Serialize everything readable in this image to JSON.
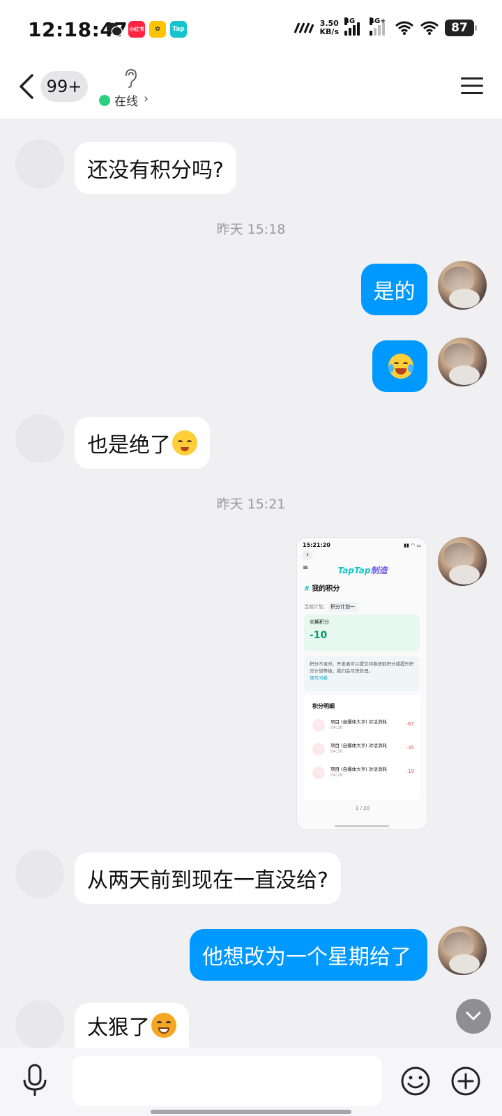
{
  "status_bar": {
    "time": "12:18:47",
    "apps": [
      "wechat-icon",
      "xiaohongshu-icon",
      "app-icon",
      "taptap-icon"
    ],
    "app_labels": {
      "xhs": "小红书",
      "tap": "Tap"
    },
    "net_speed_value": "3.50",
    "net_speed_unit": "KB/s",
    "sim1": "4G",
    "sim2": "4G+",
    "battery": "87"
  },
  "header": {
    "unread": "99+",
    "online_status": "在线",
    "online_color": "#29d17e"
  },
  "messages": [
    {
      "side": "in",
      "text": "还没有积分吗?"
    },
    {
      "timestamp": "昨天 15:18"
    },
    {
      "side": "out",
      "text": "是的"
    },
    {
      "side": "out",
      "emoji": "tears-of-joy-emoji"
    },
    {
      "side": "in",
      "text": "也是绝了",
      "emoji": "speechless-emoji"
    },
    {
      "timestamp": "昨天 15:21"
    },
    {
      "side": "out",
      "image": "screenshot-thumbnail"
    },
    {
      "side": "in",
      "text": "从两天前到现在一直没给?"
    },
    {
      "side": "out",
      "text": "他想改为一个星期给了"
    },
    {
      "side": "in",
      "text": "太狠了",
      "emoji": "dog-emoji"
    }
  ],
  "screenshot": {
    "time": "15:21:20",
    "logo_a": "TapTap",
    "logo_b": "制造",
    "title": "我的积分",
    "tab_label": "当前计划",
    "tab_value": "积分计划一",
    "card_label": "长期积分",
    "card_value": "-10",
    "note": "积分不足时，开发者可以提交问卷获取积分或提升积分计划等级，我们会尽快处理。",
    "note_link": "填写问卷",
    "detail_title": "积分明细",
    "rows": [
      {
        "name": "项目 (自爆体大亨) 对话消耗",
        "time": "04:30",
        "amount": "-67"
      },
      {
        "name": "项目 (自爆体大亨) 对话消耗",
        "time": "04:30",
        "amount": "-35"
      },
      {
        "name": "项目 (自爆体大亨) 对话消耗",
        "time": "04:29",
        "amount": "-19"
      }
    ],
    "pager": "1 / 20"
  },
  "colors": {
    "outgoing_bubble": "#0099ff",
    "incoming_bubble": "#ffffff",
    "background": "#f0f0f3"
  }
}
